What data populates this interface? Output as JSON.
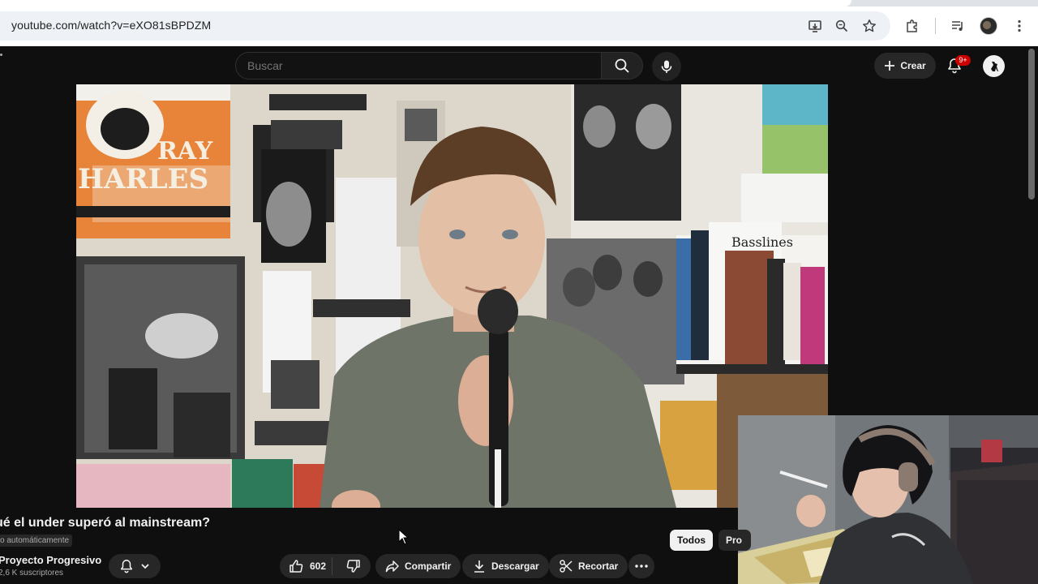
{
  "browser": {
    "url": "youtube.com/watch?v=eXO81sBPDZM"
  },
  "masthead": {
    "search_placeholder": "Buscar",
    "create_label": "Crear",
    "notification_count": "9+"
  },
  "video": {
    "title": "ué el under superó al mainstream?",
    "auto_badge": "o automáticamente",
    "channel_name": "Proyecto Progresivo",
    "subscribers": "2,6 K suscriptores",
    "likes": "602",
    "share_label": "Compartir",
    "download_label": "Descargar",
    "clip_label": "Recortar"
  },
  "chips": {
    "all": "Todos",
    "next": "Pro"
  },
  "colors": {
    "background": "#0f0f0f",
    "surface": "#272727",
    "badge_red": "#cc0000",
    "poster_orange": "#e8843a"
  }
}
